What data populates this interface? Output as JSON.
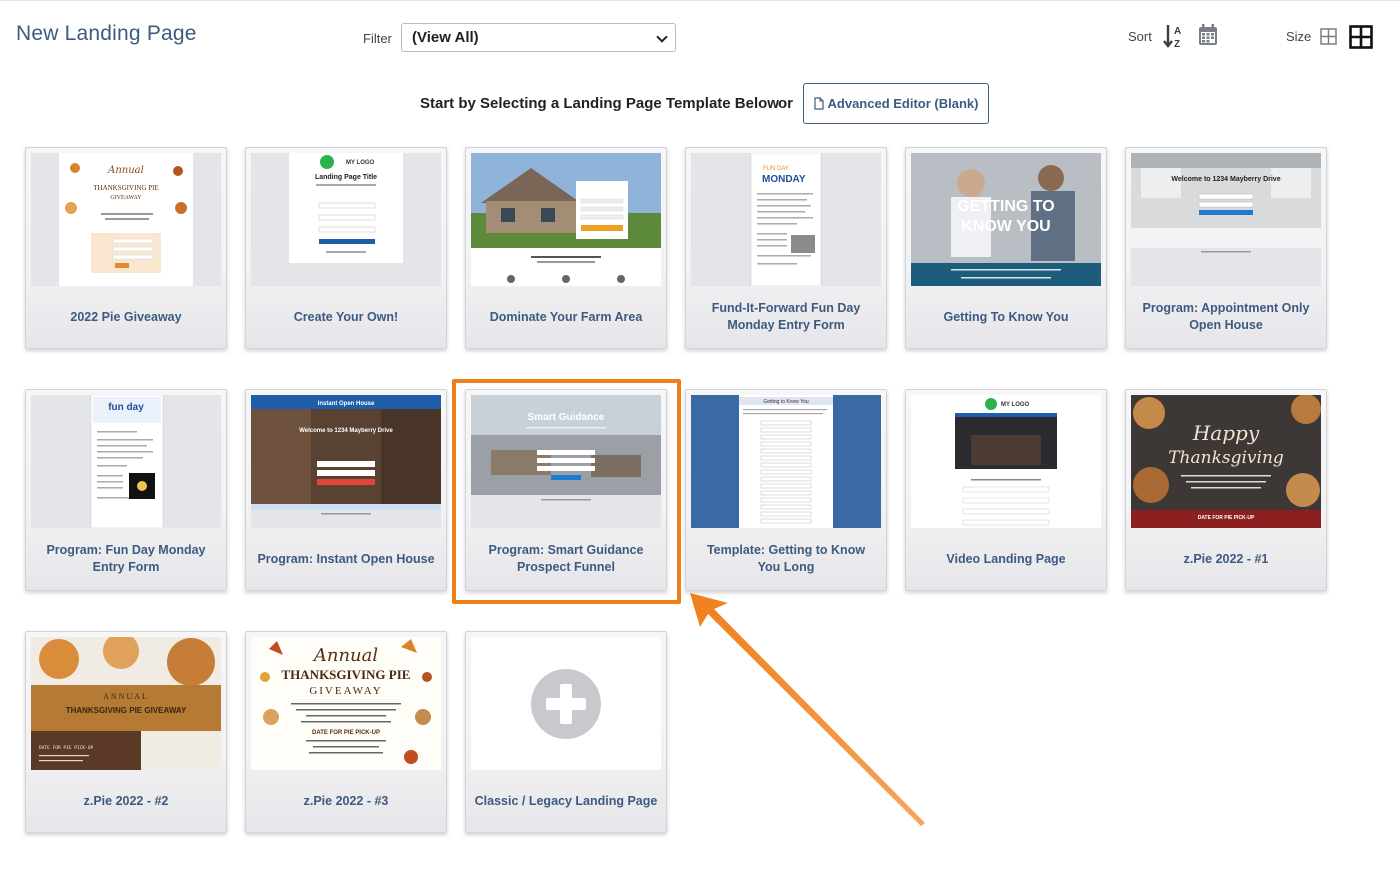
{
  "header": {
    "title": "New Landing Page",
    "filter_label": "Filter",
    "filter_value": "(View All)",
    "sort_label": "Sort",
    "size_label": "Size"
  },
  "prompt": {
    "text": "Start by Selecting a Landing Page Template Below",
    "or": "or",
    "advanced_button": "Advanced Editor (Blank)"
  },
  "colors": {
    "title": "#3d5a80",
    "highlight": "#f07f1b"
  },
  "templates": [
    {
      "label": "2022 Pie Giveaway",
      "thumb": "pie-flyer"
    },
    {
      "label": "Create Your Own!",
      "thumb": "logo-form"
    },
    {
      "label": "Dominate Your Farm Area",
      "thumb": "house-photo"
    },
    {
      "label": "Fund-It-Forward Fun Day Monday Entry Form",
      "thumb": "fun-day-doc"
    },
    {
      "label": "Getting To Know You",
      "thumb": "couple-photo"
    },
    {
      "label": "Program: Appointment Only Open House",
      "thumb": "kitchen-photo"
    },
    {
      "label": "Program: Fun Day Monday Entry Form",
      "thumb": "fun-day-doc-2"
    },
    {
      "label": "Program: Instant Open House",
      "thumb": "kitchen-dark"
    },
    {
      "label": "Program: Smart Guidance Prospect Funnel",
      "thumb": "living-room"
    },
    {
      "label": "Template: Getting to Know You Long",
      "thumb": "long-form"
    },
    {
      "label": "Video Landing Page",
      "thumb": "video-page"
    },
    {
      "label": "z.Pie 2022 - #1",
      "thumb": "pies-dark"
    },
    {
      "label": "z.Pie 2022 - #2",
      "thumb": "pie-wood"
    },
    {
      "label": "z.Pie 2022 - #3",
      "thumb": "pie-flyer-2"
    },
    {
      "label": "Classic / Legacy Landing Page",
      "thumb": "plus"
    }
  ],
  "thumb_text": {
    "pie_annual": "Annual",
    "pie_title": "THANKSGIVING PIE",
    "pie_giveaway": "GIVEAWAY",
    "mylogo": "MY LOGO",
    "landing_title": "Landing Page Title",
    "fun_day": "FUN DAY",
    "monday": "MONDAY",
    "getting_to": "GETTING TO",
    "know_you": "KNOW YOU",
    "welcome_mayberry": "Welcome to 1234 Mayberry Drive",
    "fun_day_small": "fun day",
    "instant_open_house": "Instant Open House",
    "smart_guidance": "Smart Guidance",
    "getting_to_know_you": "Getting to Know You",
    "happy": "Happy",
    "thanksgiving": "Thanksgiving",
    "date_pickup": "DATE FOR PIE PICK-UP",
    "annual_caps": "ANNUAL",
    "thanks_pie_giveaway": "THANKSGIVING PIE GIVEAWAY"
  }
}
